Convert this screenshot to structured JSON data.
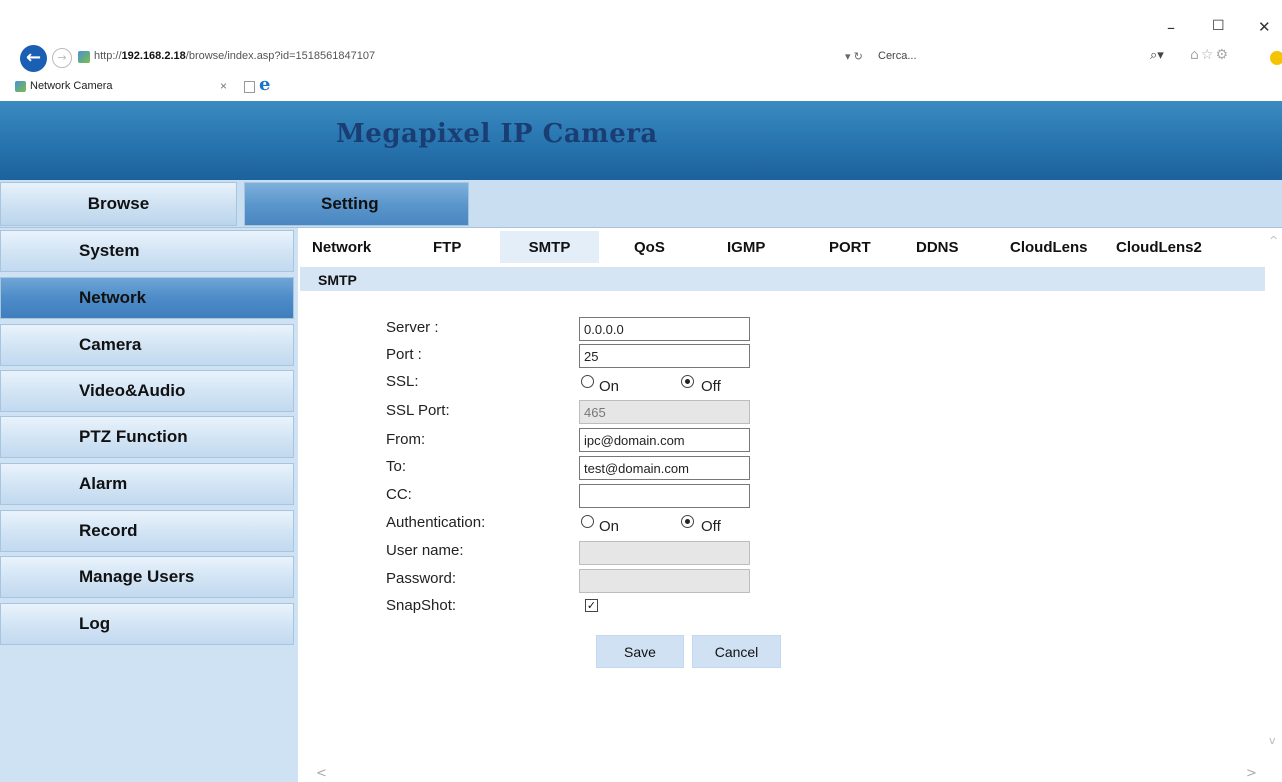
{
  "browser": {
    "url_prefix": "http://",
    "url_host": "192.168.2.18",
    "url_path": "/browse/index.asp?id=1518561847107",
    "refresh_glyph": "▾ ↻",
    "search_placeholder": "Cerca...",
    "tab_title": "Network Camera",
    "minimize": "–",
    "maximize": "☐",
    "close": "✕"
  },
  "header": {
    "title": "Megapixel IP Camera"
  },
  "topnav": {
    "browse": "Browse",
    "setting": "Setting"
  },
  "sidebar": {
    "items": [
      {
        "label": "System"
      },
      {
        "label": "Network"
      },
      {
        "label": "Camera"
      },
      {
        "label": "Video&Audio"
      },
      {
        "label": "PTZ Function"
      },
      {
        "label": "Alarm"
      },
      {
        "label": "Record"
      },
      {
        "label": "Manage Users"
      },
      {
        "label": "Log"
      }
    ],
    "active": "Network"
  },
  "subnav": {
    "tabs": [
      {
        "label": "Network"
      },
      {
        "label": "FTP"
      },
      {
        "label": "SMTP"
      },
      {
        "label": "QoS"
      },
      {
        "label": "IGMP"
      },
      {
        "label": "PORT"
      },
      {
        "label": "DDNS"
      },
      {
        "label": "CloudLens"
      },
      {
        "label": "CloudLens2"
      }
    ],
    "active": "SMTP"
  },
  "form": {
    "section_title": "SMTP",
    "server_label": "Server :",
    "server_value": "0.0.0.0",
    "port_label": "Port :",
    "port_value": "25",
    "ssl_label": "SSL:",
    "ssl_on_label": "On",
    "ssl_off_label": "Off",
    "ssl_selected": "Off",
    "ssl_port_label": "SSL Port:",
    "ssl_port_value": "465",
    "from_label": "From:",
    "from_value": "ipc@domain.com",
    "to_label": "To:",
    "to_value": "test@domain.com",
    "cc_label": "CC:",
    "cc_value": "",
    "auth_label": "Authentication:",
    "auth_on_label": "On",
    "auth_off_label": "Off",
    "auth_selected": "Off",
    "username_label": "User name:",
    "username_value": "",
    "password_label": "Password:",
    "password_value": "",
    "snapshot_label": "SnapShot:",
    "snapshot_checked": true,
    "save_label": "Save",
    "cancel_label": "Cancel"
  },
  "colors": {
    "banner": "#2a78b2",
    "banner_title": "#1a3e73",
    "nav_light": "#cfe2f3",
    "nav_active": "#4d8cc8"
  }
}
